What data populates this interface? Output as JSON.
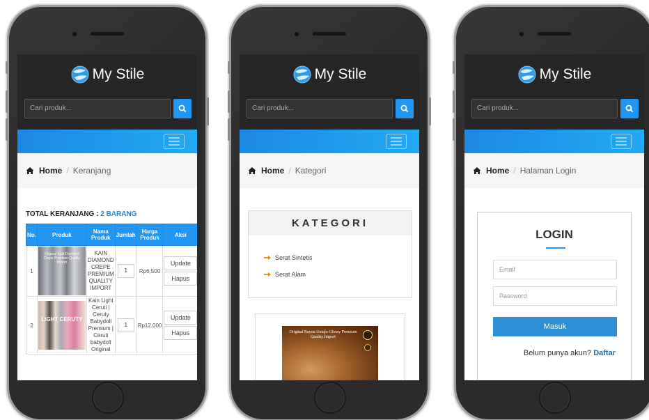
{
  "brand": {
    "name": "My Stile",
    "logo_icon": "globe-logo-icon"
  },
  "search": {
    "placeholder": "Cari produk..."
  },
  "colors": {
    "accent": "#2196f3",
    "header_bg": "#262626",
    "phone_body": "#2b2b2b"
  },
  "breadcrumb": {
    "home": "Home"
  },
  "cart": {
    "breadcrumb_current": "Keranjang",
    "total_label": "TOTAL KERANJANG :",
    "total_count": "2 BARANG",
    "headers": [
      "No.",
      "Produk",
      "Nama Produk",
      "Jumlah",
      "Harga Produk",
      "Aksi"
    ],
    "rows": [
      {
        "no": "1",
        "image_caption": "Original Kain Diamond Crepe Premium Quality Import",
        "name": "KAIN DIAMOND CREPE PREMIUM QUALITY IMPORT",
        "qty": "1",
        "price": "Rp6,500",
        "update": "Update",
        "delete": "Hapus"
      },
      {
        "no": "2",
        "image_caption": "LIGHT CERUTY",
        "name": "Kain Light Ceruti | Ceruty Babydoll Premium | Ceruti babydoll Original",
        "qty": "1",
        "price": "Rp12,000",
        "update": "Update",
        "delete": "Hapus"
      }
    ]
  },
  "kategori": {
    "breadcrumb_current": "Kategori",
    "title": "KATEGORI",
    "items": [
      "Serat Sintetis",
      "Serat Alam"
    ],
    "product_caption": "Original Rayon Uniqlo Glossy Premium Quality Import"
  },
  "login": {
    "breadcrumb_current": "Halaman Login",
    "title": "LOGIN",
    "email_placeholder": "Email",
    "password_placeholder": "Password",
    "submit": "Masuk",
    "footer_text": "Belum punya akun?",
    "footer_link": "Daftar"
  }
}
